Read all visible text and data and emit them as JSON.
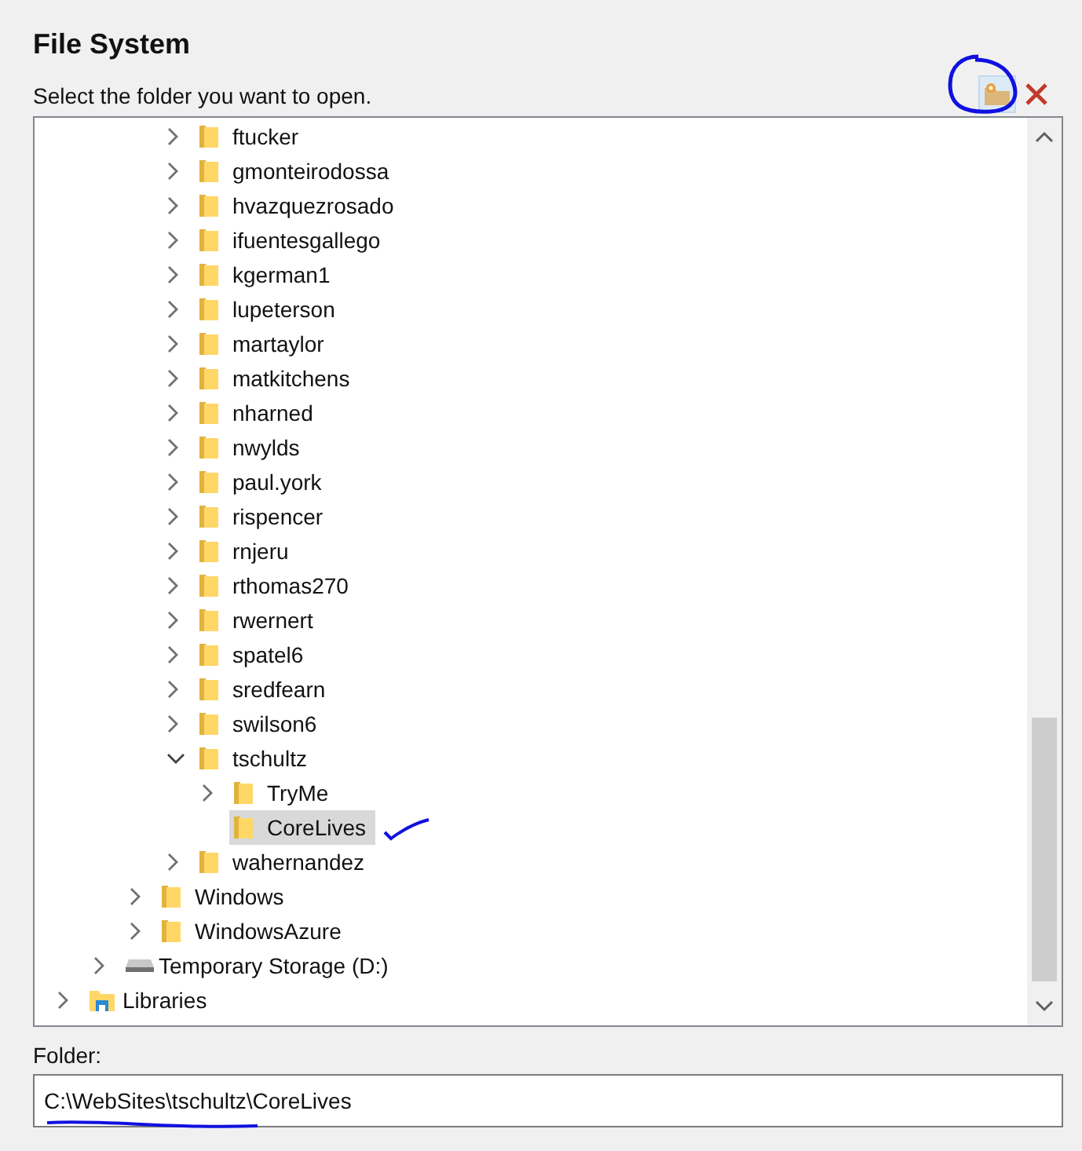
{
  "title": "File System",
  "subtitle": "Select the folder you want to open.",
  "toolbar": [
    {
      "kind": "new-folder"
    },
    {
      "kind": "close"
    }
  ],
  "tree": [
    {
      "children": [
        {
          "children": [
            {
              "children": [
                {
                  "label": "ftucker",
                  "kind": "folder",
                  "expandable": true,
                  "expanded": false,
                  "selected": false
                },
                {
                  "label": "gmonteirodossa",
                  "kind": "folder",
                  "expandable": true,
                  "expanded": false,
                  "selected": false
                },
                {
                  "label": "hvazquezrosado",
                  "kind": "folder",
                  "expandable": true,
                  "expanded": false,
                  "selected": false
                },
                {
                  "label": "ifuentesgallego",
                  "kind": "folder",
                  "expandable": true,
                  "expanded": false,
                  "selected": false
                },
                {
                  "label": "kgerman1",
                  "kind": "folder",
                  "expandable": true,
                  "expanded": false,
                  "selected": false
                },
                {
                  "label": "lupeterson",
                  "kind": "folder",
                  "expandable": true,
                  "expanded": false,
                  "selected": false
                },
                {
                  "label": "martaylor",
                  "kind": "folder",
                  "expandable": true,
                  "expanded": false,
                  "selected": false
                },
                {
                  "label": "matkitchens",
                  "kind": "folder",
                  "expandable": true,
                  "expanded": false,
                  "selected": false
                },
                {
                  "label": "nharned",
                  "kind": "folder",
                  "expandable": true,
                  "expanded": false,
                  "selected": false
                },
                {
                  "label": "nwylds",
                  "kind": "folder",
                  "expandable": true,
                  "expanded": false,
                  "selected": false
                },
                {
                  "label": "paul.york",
                  "kind": "folder",
                  "expandable": true,
                  "expanded": false,
                  "selected": false
                },
                {
                  "label": "rispencer",
                  "kind": "folder",
                  "expandable": true,
                  "expanded": false,
                  "selected": false
                },
                {
                  "label": "rnjeru",
                  "kind": "folder",
                  "expandable": true,
                  "expanded": false,
                  "selected": false
                },
                {
                  "label": "rthomas270",
                  "kind": "folder",
                  "expandable": true,
                  "expanded": false,
                  "selected": false
                },
                {
                  "label": "rwernert",
                  "kind": "folder",
                  "expandable": true,
                  "expanded": false,
                  "selected": false
                },
                {
                  "label": "spatel6",
                  "kind": "folder",
                  "expandable": true,
                  "expanded": false,
                  "selected": false
                },
                {
                  "label": "sredfearn",
                  "kind": "folder",
                  "expandable": true,
                  "expanded": false,
                  "selected": false
                },
                {
                  "label": "swilson6",
                  "kind": "folder",
                  "expandable": true,
                  "expanded": false,
                  "selected": false
                },
                {
                  "label": "tschultz",
                  "kind": "folder",
                  "expandable": true,
                  "expanded": true,
                  "selected": false,
                  "children": [
                    {
                      "label": "TryMe",
                      "kind": "folder",
                      "expandable": true,
                      "expanded": false,
                      "selected": false
                    },
                    {
                      "label": "CoreLives",
                      "kind": "folder",
                      "expandable": false,
                      "selected": true
                    }
                  ]
                },
                {
                  "label": "wahernandez",
                  "kind": "folder",
                  "expandable": true,
                  "expanded": false,
                  "selected": false
                }
              ]
            },
            {
              "label": "Windows",
              "kind": "folder",
              "expandable": true,
              "expanded": false,
              "selected": false
            },
            {
              "label": "WindowsAzure",
              "kind": "folder",
              "expandable": true,
              "expanded": false,
              "selected": false
            }
          ]
        },
        {
          "label": "Temporary Storage (D:)",
          "kind": "drive",
          "expandable": true,
          "expanded": false,
          "selected": false
        }
      ]
    },
    {
      "label": "Libraries",
      "kind": "library",
      "expandable": true,
      "expanded": false,
      "selected": false
    }
  ],
  "folder_field": {
    "label": "Folder:",
    "value": "C:\\WebSites\\tschultz\\CoreLives"
  }
}
